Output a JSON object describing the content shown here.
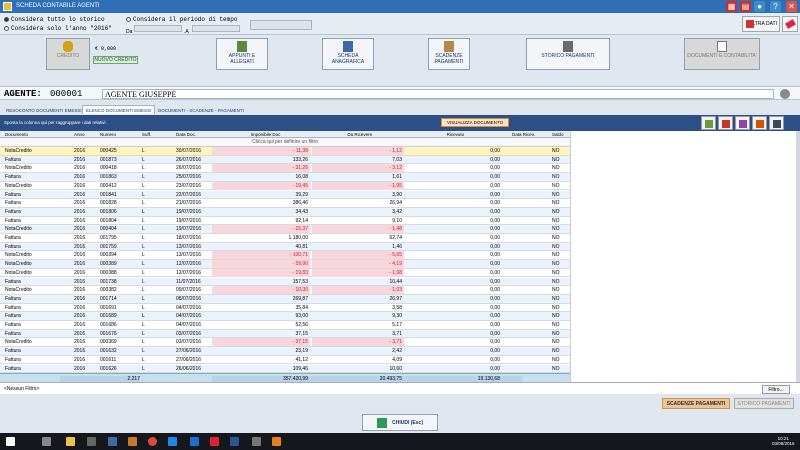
{
  "window": {
    "title": "SCHEDA CONTABILE AGENTI"
  },
  "filters": {
    "all_history": "Considera tutto lo storico",
    "only_year": "Considera solo l'anno \"2016\"",
    "period": "Considera il periodo di tempo",
    "da_label": "Da",
    "a_label": ".A",
    "filtra_label": "FILTRA DATI"
  },
  "toolbar": {
    "credito": "CREDITO",
    "credit_value": "€ 0,000",
    "nuovo_credito": "NUOVO CREDITO",
    "appunti": "APPUNTI E ALLEGATI",
    "anagrafica": "SCHEDA ANAGRAFICA",
    "scadenze": "SCADENZE PAGAMENTI",
    "storico": "STORICO PAGAMENTI",
    "documenti": "DOCUMENTI E CONTABILITA'"
  },
  "agent": {
    "label": "AGENTE:",
    "code": "000001",
    "name": "AGENTE GIUSEPPE"
  },
  "tabs": [
    "RESOCONTO DOCUMENTI EMESSI",
    "ELENCO DOCUMENTI EMESSI",
    "DOCUMENTI - SCADENZE - PAGAMENTI"
  ],
  "grid": {
    "group_hint": "Sposta la colonna qui per raggruppare i dati relativi",
    "visualizza": "VISUALIZZA DOCUMENTO",
    "filter_prompt": "Clicca qui per definire un filtro",
    "columns": [
      "Documento",
      "Anno",
      "Numero",
      "Suff.",
      "Data Doc.",
      "Imponibile Doc",
      "Da Ricevere",
      "Ricevuto",
      "Data Ricev.",
      "Saldo"
    ],
    "rows": [
      [
        "NotaCredito",
        "2016",
        "000425",
        "L",
        "30/07/2016",
        "- 11,38",
        "- 1,12",
        "0,00",
        "",
        "NO"
      ],
      [
        "Fattura",
        "2016",
        "001873",
        "L",
        "26/07/2016",
        "133,26",
        "7,03",
        "0,00",
        "",
        "NO"
      ],
      [
        "NotaCredito",
        "2016",
        "000418",
        "L",
        "26/07/2016",
        "- 31,26",
        "- 3,12",
        "0,00",
        "",
        "NO"
      ],
      [
        "Fattura",
        "2016",
        "001863",
        "L",
        "25/07/2016",
        "16,08",
        "1,61",
        "0,00",
        "",
        "NO"
      ],
      [
        "NotaCredito",
        "2016",
        "000412",
        "L",
        "23/07/2016",
        "- 19,45",
        "- 1,95",
        "0,00",
        "",
        "NO"
      ],
      [
        "Fattura",
        "2016",
        "001841",
        "L",
        "22/07/2016",
        "39,29",
        "3,90",
        "0,00",
        "",
        "NO"
      ],
      [
        "Fattura",
        "2016",
        "001828",
        "L",
        "21/07/2016",
        "386,46",
        "26,94",
        "0,00",
        "",
        "NO"
      ],
      [
        "Fattura",
        "2016",
        "001806",
        "L",
        "19/07/2016",
        "34,43",
        "3,42",
        "0,00",
        "",
        "NO"
      ],
      [
        "Fattura",
        "2016",
        "001804",
        "L",
        "19/07/2016",
        "92,14",
        "9,10",
        "0,00",
        "",
        "NO"
      ],
      [
        "NotaCredito",
        "2016",
        "000404",
        "L",
        "19/07/2016",
        "- 15,37",
        "- 1,48",
        "0,00",
        "",
        "NO"
      ],
      [
        "Fattura",
        "2016",
        "001795",
        "L",
        "18/07/2016",
        "1.180,00",
        "62,74",
        "0,00",
        "",
        "NO"
      ],
      [
        "Fattura",
        "2016",
        "001759",
        "L",
        "13/07/2016",
        "40,81",
        "1,46",
        "0,00",
        "",
        "NO"
      ],
      [
        "NotaCredito",
        "2016",
        "000394",
        "L",
        "13/07/2016",
        "- 100,71",
        "- 5,65",
        "0,00",
        "",
        "NO"
      ],
      [
        "NotaCredito",
        "2016",
        "000389",
        "L",
        "12/07/2016",
        "- 59,90",
        "- 4,19",
        "0,00",
        "",
        "NO"
      ],
      [
        "NotaCredito",
        "2016",
        "000388",
        "L",
        "12/07/2016",
        "- 19,83",
        "- 1,98",
        "0,00",
        "",
        "NO"
      ],
      [
        "Fattura",
        "2016",
        "001738",
        "L",
        "11/07/2016",
        "157,53",
        "10,44",
        "0,00",
        "",
        "NO"
      ],
      [
        "NotaCredito",
        "2016",
        "000382",
        "L",
        "09/07/2016",
        "- 10,30",
        "- 1,03",
        "0,00",
        "",
        "NO"
      ],
      [
        "Fattura",
        "2016",
        "001714",
        "L",
        "08/07/2016",
        "269,87",
        "26,97",
        "0,00",
        "",
        "NO"
      ],
      [
        "Fattura",
        "2016",
        "001691",
        "L",
        "04/07/2016",
        "35,84",
        "3,58",
        "0,00",
        "",
        "NO"
      ],
      [
        "Fattura",
        "2016",
        "001689",
        "L",
        "04/07/2016",
        "93,00",
        "9,30",
        "0,00",
        "",
        "NO"
      ],
      [
        "Fattura",
        "2016",
        "001686",
        "L",
        "04/07/2016",
        "52,56",
        "5,17",
        "0,00",
        "",
        "NO"
      ],
      [
        "Fattura",
        "2016",
        "001676",
        "L",
        "03/07/2016",
        "37,15",
        "3,71",
        "0,00",
        "",
        "NO"
      ],
      [
        "NotaCredito",
        "2016",
        "000369",
        "L",
        "03/07/2016",
        "- 37,15",
        "- 3,71",
        "0,00",
        "",
        "NO"
      ],
      [
        "Fattura",
        "2016",
        "001632",
        "L",
        "27/06/2016",
        "23,19",
        "2,42",
        "0,00",
        "",
        "NO"
      ],
      [
        "Fattura",
        "2016",
        "001611",
        "L",
        "27/06/2016",
        "41,12",
        "4,09",
        "0,00",
        "",
        "NO"
      ],
      [
        "Fattura",
        "2016",
        "001626",
        "L",
        "26/06/2016",
        "109,46",
        "10,60",
        "0,00",
        "",
        "NO"
      ]
    ],
    "totals": {
      "numero": "2.217",
      "imponibile": "357.420,99",
      "da_ricevere": "20.493,75",
      "ricevuto": "19.130,68"
    }
  },
  "footer": {
    "no_filter": "<Nessun Filtro>",
    "filtro": "Filtro...",
    "scadenze": "SCADENZE PAGAMENTI",
    "storico": "STORICO PAGAMENTI",
    "chiudi": "CHIUDI (Esc)"
  },
  "taskbar": {
    "time": "10:21",
    "date": "03/08/2016"
  }
}
